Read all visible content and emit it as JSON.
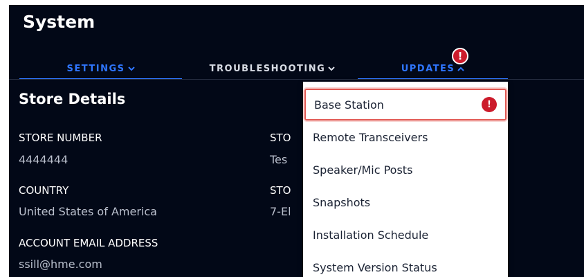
{
  "page": {
    "title": "System"
  },
  "tabs": [
    {
      "label": "SETTINGS",
      "chevron": "chevron-down-icon",
      "active": true
    },
    {
      "label": "TROUBLESHOOTING",
      "chevron": "chevron-down-icon",
      "active": false
    },
    {
      "label": "UPDATES",
      "chevron": "chevron-up-icon",
      "active": true,
      "badge": "!"
    }
  ],
  "store_details": {
    "title": "Store Details",
    "fields": [
      {
        "label": "STORE NUMBER",
        "value": "4444444"
      },
      {
        "label": "STO",
        "value": "Tes"
      },
      {
        "label": "COUNTRY",
        "value": "United States of America"
      },
      {
        "label": "STO",
        "value": "7-El"
      },
      {
        "label": "ACCOUNT EMAIL ADDRESS",
        "value": "ssill@hme.com"
      }
    ]
  },
  "updates_menu": {
    "items": [
      {
        "label": "Base Station",
        "badge": "!",
        "highlighted": true
      },
      {
        "label": "Remote Transceivers"
      },
      {
        "label": "Speaker/Mic Posts"
      },
      {
        "label": "Snapshots"
      },
      {
        "label": "Installation Schedule"
      },
      {
        "label": "System Version Status"
      }
    ]
  },
  "colors": {
    "background": "#020817",
    "accent": "#2f76ff",
    "alert": "#cc1b2b",
    "highlight_border": "#e25a54",
    "menu_bg": "#ffffff"
  }
}
